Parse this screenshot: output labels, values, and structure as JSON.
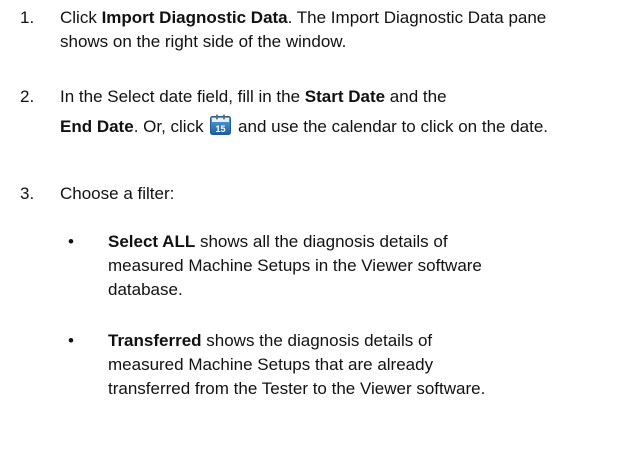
{
  "steps": [
    {
      "number": "1.",
      "parts": {
        "pre": "Click ",
        "bold": "Import Diagnostic Data",
        "post": ". The Import Diagnostic Data pane shows on the right side of the window."
      }
    },
    {
      "number": "2.",
      "parts": {
        "pre": "In the Select date field, fill in the ",
        "bold1": "Start Date",
        "mid": " and the ",
        "bold2": "End Date",
        "post1": ". Or, click ",
        "post2": " and use the calendar to click on the date."
      },
      "icon": {
        "name": "calendar-icon",
        "day": "15",
        "colors": {
          "body": "#2f86c9",
          "body_dark": "#1d5f99",
          "top": "#ffffff"
        }
      }
    },
    {
      "number": "3.",
      "text": "Choose a filter:"
    }
  ],
  "bullets": [
    {
      "glyph": "•",
      "bold": "Select ALL",
      "text": " shows all the diagnosis details of measured Machine Setups in the Viewer software database."
    },
    {
      "glyph": "•",
      "bold": "Transferred",
      "text": " shows the diagnosis details of measured Machine Setups that are already transferred from the Tester to the Viewer software."
    }
  ]
}
